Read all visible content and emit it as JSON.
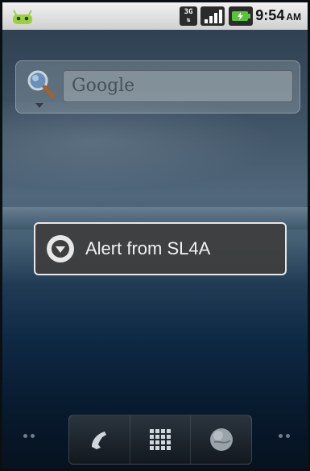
{
  "status_bar": {
    "network_type": "3G",
    "time": "9:54",
    "ampm": "AM"
  },
  "search": {
    "placeholder": "Google"
  },
  "toast": {
    "message": "Alert from SL4A"
  },
  "dock": {
    "items": [
      {
        "icon": "phone-icon"
      },
      {
        "icon": "app-drawer-icon"
      },
      {
        "icon": "browser-globe-icon"
      }
    ]
  },
  "colors": {
    "toast_bg": "#3e3e3e",
    "toast_border": "#e8e8e8"
  }
}
